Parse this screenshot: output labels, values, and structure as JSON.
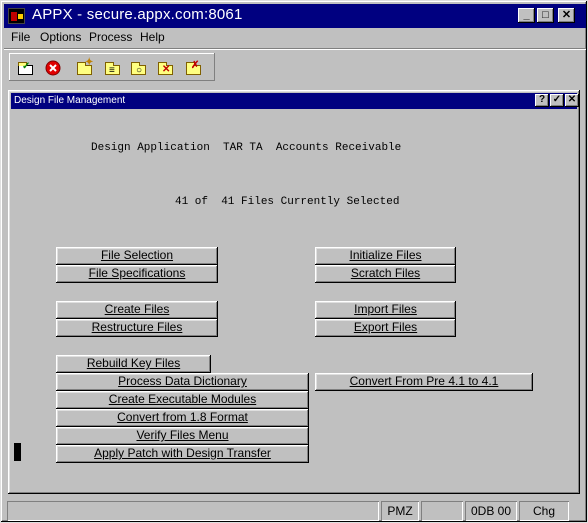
{
  "window": {
    "title": "APPX - secure.appx.com:8061"
  },
  "menubar": {
    "items": [
      "File",
      "Options",
      "Process",
      "Help"
    ]
  },
  "toolbar": {
    "icons": [
      "ok-check-icon",
      "cancel-icon",
      "new-folder-icon",
      "open-folder-icon",
      "search-folder-icon",
      "move-folder-icon",
      "delete-folder-icon"
    ]
  },
  "dialog": {
    "title": "Design File Management",
    "buttons": [
      "?",
      "✓",
      "✕"
    ],
    "header_line": "Design Application  TAR TA  Accounts Receivable",
    "selection_line": "41 of  41 Files Currently Selected"
  },
  "buttons": {
    "file_selection": "File Selection",
    "file_specifications": "File Specifications",
    "initialize_files": "Initialize Files",
    "scratch_files": "Scratch Files",
    "create_files": "Create Files",
    "restructure_files": "Restructure Files",
    "import_files": "Import Files",
    "export_files": "Export Files",
    "rebuild_key_files": "Rebuild Key Files",
    "process_data_dictionary": "Process Data Dictionary",
    "convert_from_pre": "Convert From Pre 4.1 to 4.1",
    "create_executable_modules": "Create Executable Modules",
    "convert_from_18": "Convert from 1.8 Format",
    "verify_files_menu": "Verify Files Menu",
    "apply_patch": "Apply Patch with Design Transfer"
  },
  "statusbar": {
    "panels": [
      "",
      "PMZ",
      "",
      "0DB 00",
      "Chg"
    ]
  }
}
